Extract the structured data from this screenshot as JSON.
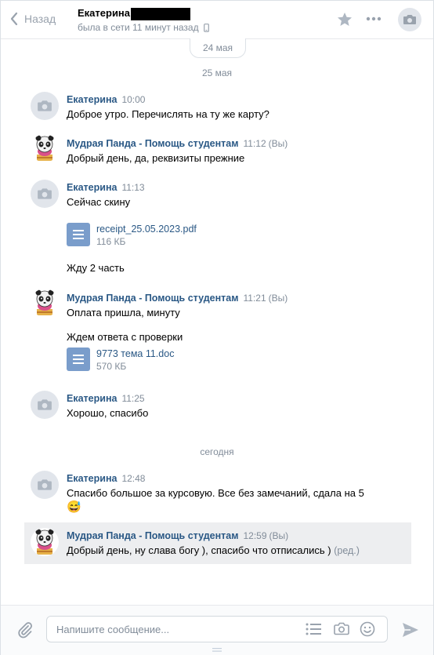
{
  "header": {
    "back_label": "Назад",
    "name": "Екатерина",
    "status": "была в сети 11 минут назад"
  },
  "dates": {
    "pill": "24 мая",
    "may25": "25 мая",
    "today": "сегодня"
  },
  "messages": [
    {
      "author": "Екатерина",
      "time": "10:00",
      "lines": [
        "Доброе утро. Перечислять на ту же карту?"
      ]
    },
    {
      "author": "Мудрая Панда - Помощь студентам",
      "time": "11:12",
      "you": "(Вы)",
      "lines": [
        "Добрый день, да, реквизиты прежние"
      ]
    },
    {
      "author": "Екатерина",
      "time": "11:13",
      "lines": [
        "Сейчас скину",
        "Жду 2 часть"
      ],
      "file": {
        "name": "receipt_25.05.2023.pdf",
        "size": "116 КБ"
      }
    },
    {
      "author": "Мудрая Панда - Помощь студентам",
      "time": "11:21",
      "you": "(Вы)",
      "lines": [
        "Оплата пришла, минуту",
        "Ждем ответа с проверки"
      ],
      "file": {
        "name": "9773 тема 11.doc",
        "size": "570 КБ"
      }
    },
    {
      "author": "Екатерина",
      "time": "11:25",
      "lines": [
        "Хорошо, спасибо"
      ]
    },
    {
      "author": "Екатерина",
      "time": "12:48",
      "lines": [
        "Спасибо большое за курсовую. Все без замечаний, сдала на 5"
      ],
      "emoji": "😅"
    },
    {
      "author": "Мудрая Панда - Помощь студентам",
      "time": "12:59",
      "you": "(Вы)",
      "lines": [
        "Добрый день, ну слава богу ), спасибо что отписались )"
      ],
      "edited": "(ред.)"
    }
  ],
  "composer": {
    "placeholder": "Напишите сообщение..."
  },
  "colors": {
    "link": "#2a5885",
    "muted": "#818c99",
    "highlight": "#edeef0",
    "file_icon": "#7a9dcb"
  }
}
